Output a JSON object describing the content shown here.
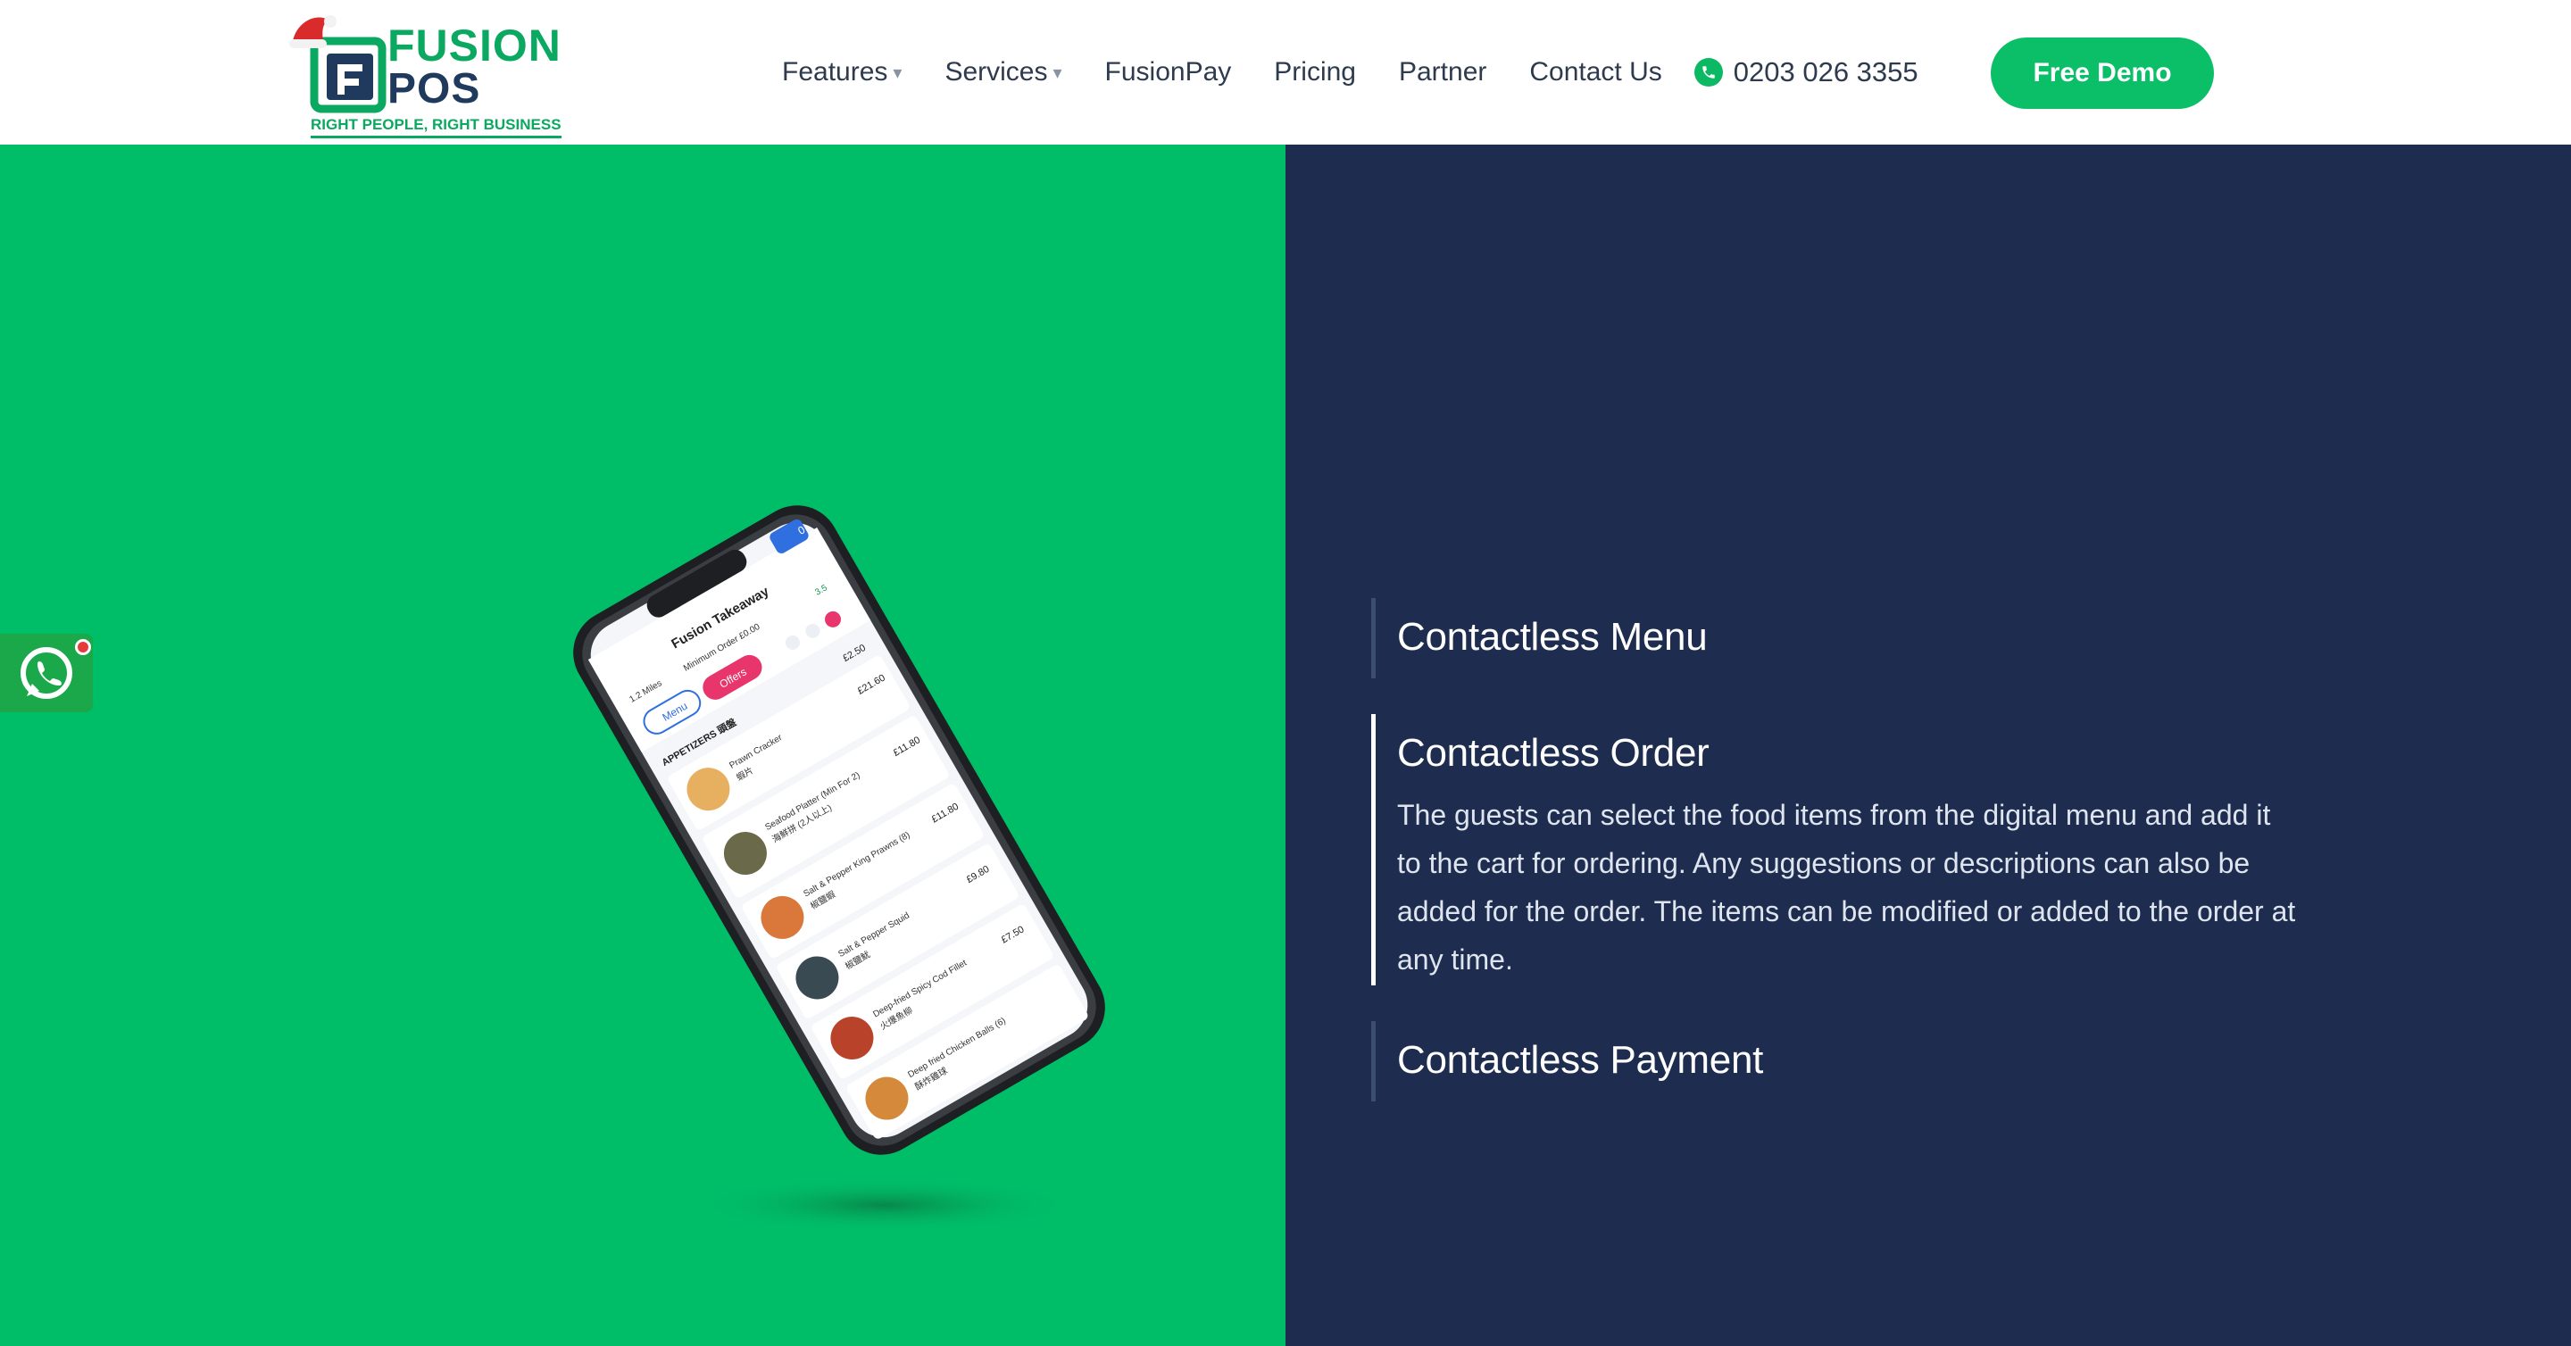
{
  "logo": {
    "word1": "FUSION",
    "word2": "POS",
    "tagline": "RIGHT PEOPLE, RIGHT BUSINESS"
  },
  "nav": {
    "items": [
      {
        "label": "Features",
        "has_dropdown": true
      },
      {
        "label": "Services",
        "has_dropdown": true
      },
      {
        "label": "FusionPay",
        "has_dropdown": false
      },
      {
        "label": "Pricing",
        "has_dropdown": false
      },
      {
        "label": "Partner",
        "has_dropdown": false
      },
      {
        "label": "Contact Us",
        "has_dropdown": false
      }
    ],
    "caret": "▾",
    "phone": "0203 026 3355",
    "cta": "Free Demo"
  },
  "phone_screen": {
    "restaurant": "Fusion Takeaway",
    "rating": "3.5",
    "distance": "1.2 Miles",
    "min_order": "Minimum Order £0.00",
    "tab_menu": "Menu",
    "tab_offers": "Offers",
    "cart_count": "0",
    "section": "APPETIZERS 頭盤",
    "section_price": "£2.50",
    "items": [
      {
        "name": "Prawn Cracker",
        "cn": "蝦片",
        "price": "£21.60"
      },
      {
        "name": "Seafood Platter (Min For 2)",
        "cn": "海鮮拼 (2人以上)",
        "price": "£11.80"
      },
      {
        "name": "Salt & Pepper King Prawns (8)",
        "cn": "椒鹽蝦",
        "price": "£11.80"
      },
      {
        "name": "Salt & Pepper Squid",
        "cn": "椒鹽魷",
        "price": "£9.80"
      },
      {
        "name": "Deep-fried Spicy Cod Fillet",
        "cn": "火爆魚柳",
        "price": "£7.50"
      },
      {
        "name": "Deep fried Chicken Balls (6)",
        "cn": "酥炸雞球",
        "price": ""
      }
    ]
  },
  "features": [
    {
      "title": "Contactless Menu",
      "desc": "",
      "active": false
    },
    {
      "title": "Contactless Order",
      "desc": "The guests can select the food items from the digital menu and add it to the cart for ordering. Any suggestions or descriptions can also be added for the order. The items can be modified or added to the order at any time.",
      "active": true
    },
    {
      "title": "Contactless Payment",
      "desc": "",
      "active": false
    }
  ],
  "colors": {
    "brand_green": "#00bd68",
    "navy": "#1e2d4f",
    "offers_pink": "#e8356b"
  }
}
